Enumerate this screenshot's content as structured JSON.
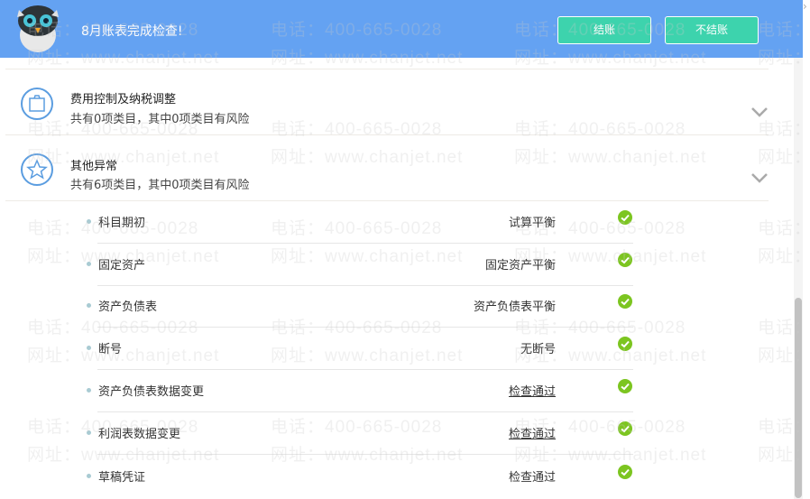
{
  "header": {
    "title": "8月账表完成检查!",
    "buttons": {
      "close_account": "结账",
      "no_close_account": "不结账"
    },
    "bg_color": "#64a2f2",
    "button_color": "#3dd3ad",
    "mascot_icon": "owl-icon"
  },
  "watermark": {
    "phone": "电话：400-665-0028",
    "site": "网址：www.chanjet.net"
  },
  "sections": [
    {
      "title": "费用控制及纳税调整",
      "subtitle": "共有0项类目，其中0项类目有风险",
      "icon": "clipboard-icon"
    },
    {
      "title": "其他异常",
      "subtitle": "共有6项类目，其中0项类目有风险",
      "icon": "star-icon"
    }
  ],
  "items": [
    {
      "label": "科目期初",
      "result": "试算平衡",
      "link": false
    },
    {
      "label": "固定资产",
      "result": "固定资产平衡",
      "link": false
    },
    {
      "label": "资产负债表",
      "result": "资产负债表平衡",
      "link": false
    },
    {
      "label": "断号",
      "result": "无断号",
      "link": false
    },
    {
      "label": "资产负债表数据变更",
      "result": "检查通过",
      "link": true
    },
    {
      "label": "利润表数据变更",
      "result": "检查通过",
      "link": true
    },
    {
      "label": "草稿凭证",
      "result": "检查通过",
      "link": false
    }
  ],
  "status_color": "#7cc520"
}
